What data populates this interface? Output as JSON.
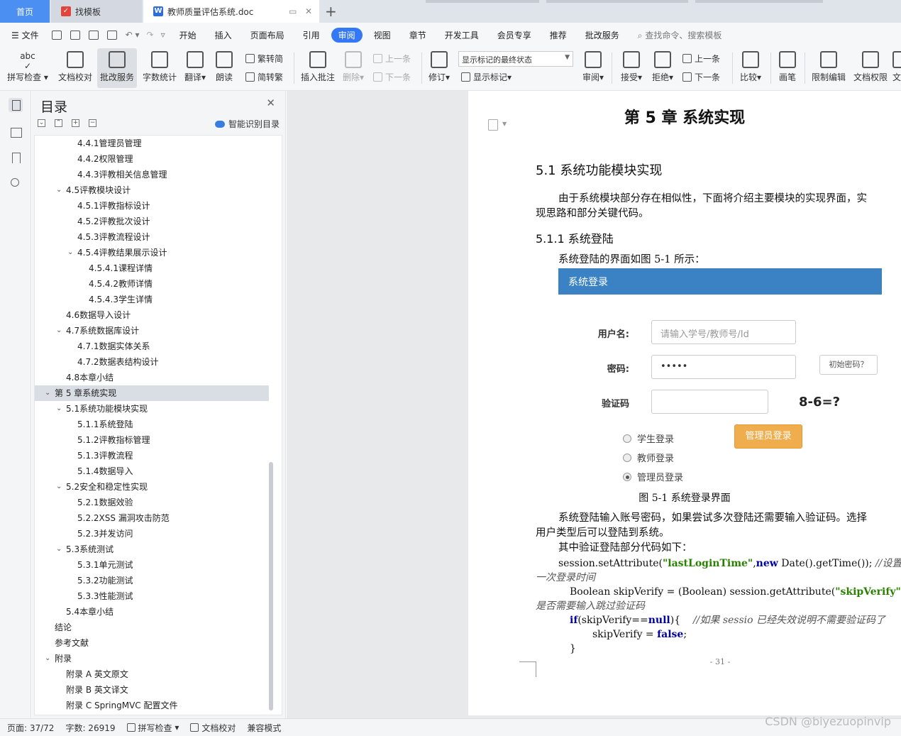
{
  "tabs": {
    "home": "首页",
    "template": "找模板",
    "doc": "教师质量评估系统.doc"
  },
  "menu": {
    "file": "文件",
    "items": [
      "开始",
      "插入",
      "页面布局",
      "引用",
      "审阅",
      "视图",
      "章节",
      "开发工具",
      "会员专享",
      "推荐",
      "批改服务"
    ],
    "active": "审阅",
    "search": "查找命令、搜索模板"
  },
  "ribbon": {
    "spell_check": "拼写检查",
    "doc_proof": "文档校对",
    "correction_service": "批改服务",
    "word_count": "字数统计",
    "translate": "翻译",
    "read_aloud": "朗读",
    "trad_to_simp": "繁转简",
    "simp_to_trad": "简转繁",
    "insert_comment": "插入批注",
    "delete": "删除",
    "prev": "上一条",
    "next": "下一条",
    "revise": "修订",
    "status_dropdown": "显示标记的最终状态",
    "show_marks": "显示标记",
    "review": "审阅",
    "accept": "接受",
    "reject": "拒绝",
    "prev2": "上一条",
    "next2": "下一条",
    "compare": "比较",
    "pen": "画笔",
    "restrict_edit": "限制编辑",
    "doc_permission": "文档权限",
    "cut": "文"
  },
  "toc": {
    "title": "目录",
    "smart": "智能识别目录",
    "items": [
      {
        "label": "4.4.1管理员管理",
        "level": 3
      },
      {
        "label": "4.4.2权限管理",
        "level": 3
      },
      {
        "label": "4.4.3评教相关信息管理",
        "level": 3
      },
      {
        "label": "4.5评教模块设计",
        "level": 2,
        "arrow": true
      },
      {
        "label": "4.5.1评教指标设计",
        "level": 3
      },
      {
        "label": "4.5.2评教批次设计",
        "level": 3
      },
      {
        "label": "4.5.3评教流程设计",
        "level": 3
      },
      {
        "label": "4.5.4评教结果展示设计",
        "level": 3,
        "arrow": true
      },
      {
        "label": "4.5.4.1课程详情",
        "level": 4
      },
      {
        "label": "4.5.4.2教师详情",
        "level": 4
      },
      {
        "label": "4.5.4.3学生详情",
        "level": 4
      },
      {
        "label": "4.6数据导入设计",
        "level": 2
      },
      {
        "label": "4.7系统数据库设计",
        "level": 2,
        "arrow": true
      },
      {
        "label": "4.7.1数据实体关系",
        "level": 3
      },
      {
        "label": "4.7.2数据表结构设计",
        "level": 3
      },
      {
        "label": "4.8本章小结",
        "level": 2
      },
      {
        "label": "第 5 章系统实现",
        "level": 1,
        "arrow": true,
        "selected": true
      },
      {
        "label": "5.1系统功能模块实现",
        "level": 2,
        "arrow": true
      },
      {
        "label": "5.1.1系统登陆",
        "level": 3
      },
      {
        "label": "5.1.2评教指标管理",
        "level": 3
      },
      {
        "label": "5.1.3评教流程",
        "level": 3
      },
      {
        "label": "5.1.4数据导入",
        "level": 3
      },
      {
        "label": "5.2安全和稳定性实现",
        "level": 2,
        "arrow": true
      },
      {
        "label": "5.2.1数据效验",
        "level": 3
      },
      {
        "label": "5.2.2XSS 漏洞攻击防范",
        "level": 3
      },
      {
        "label": "5.2.3并发访问",
        "level": 3
      },
      {
        "label": "5.3系统测试",
        "level": 2,
        "arrow": true
      },
      {
        "label": "5.3.1单元测试",
        "level": 3
      },
      {
        "label": "5.3.2功能测试",
        "level": 3
      },
      {
        "label": "5.3.3性能测试",
        "level": 3
      },
      {
        "label": "5.4本章小结",
        "level": 2
      },
      {
        "label": "结论",
        "level": 1
      },
      {
        "label": "参考文献",
        "level": 1
      },
      {
        "label": "附录",
        "level": 1,
        "arrow": true
      },
      {
        "label": "附录 A  英文原文",
        "level": 2
      },
      {
        "label": "附录 B  英文译文",
        "level": 2
      },
      {
        "label": "附录 C SpringMVC 配置文件",
        "level": 2
      }
    ]
  },
  "document": {
    "chapter_title": "第 5 章  系统实现",
    "h2": "5.1  系统功能模块实现",
    "p1_line1": "由于系统模块部分存在相似性，下面将介绍主要模块的实现界面，实",
    "p1_line2": "现思路和部分关键代码。",
    "h3": "5.1.1  系统登陆",
    "p2": "系统登陆的界面如图 5-1 所示：",
    "login": {
      "bar_title": "系统登录",
      "username_label": "用户名:",
      "username_placeholder": "请输入学号/教师号/Id",
      "password_label": "密码:",
      "password_value": "•••••",
      "init_password": "初始密码？",
      "captcha_label": "验证码",
      "captcha_question": "8-6=?",
      "radio_student": "学生登录",
      "radio_teacher": "教师登录",
      "radio_admin": "管理员登录",
      "admin_button": "管理员登录"
    },
    "figure_caption": "图  5-1  系统登录界面",
    "p3_line1": "系统登陆输入账号密码，如果尝试多次登陆还需要输入验证码。选择",
    "p3_line2": "用户类型后可以登陆到系统。",
    "p4": "其中验证登陆部分代码如下：",
    "code": {
      "l1_a": "session.setAttribute(",
      "l1_str": "\"lastLoginTime\"",
      "l1_b": ",",
      "l1_kw": "new",
      "l1_c": " Date().getTime());",
      "l1_cm": "//设置最后",
      "l2_cm": "一次登录时间",
      "l3_a": "Boolean skipVerify = (Boolean) session.getAttribute(",
      "l3_str": "\"skipVerify\"",
      "l3_b": ");",
      "l3_cm": "//",
      "l4_cm": "是否需要输入跳过验证码",
      "l5_kw": "if",
      "l5_a": "(skipVerify==",
      "l5_kw2": "null",
      "l5_b": "){",
      "l5_cm": "//如果 sessio 已经失效说明不需要验证码了",
      "l6_a": "skipVerify = ",
      "l6_kw": "false",
      "l6_b": ";",
      "l7": "}"
    },
    "page_number": "- 31 -"
  },
  "status": {
    "page": "页面: 37/72",
    "words": "字数: 26919",
    "spell": "拼写检查",
    "proof": "文档校对",
    "compat": "兼容模式"
  },
  "watermark": "CSDN @biyezuopinvip"
}
